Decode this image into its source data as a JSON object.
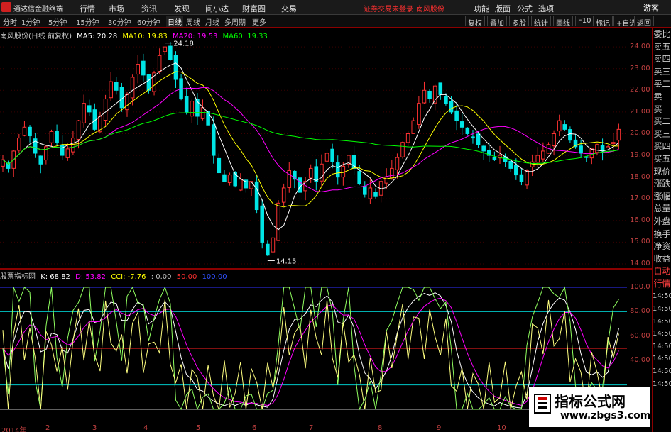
{
  "menubar": {
    "app_title": "通达信金融终端",
    "menus": [
      "行情",
      "市场",
      "资讯",
      "发现",
      "问小达",
      "财富圈",
      "交易"
    ],
    "warning": "证券交易未登录",
    "stock_name": "南风股份",
    "right_items": [
      "功能",
      "版面",
      "公式",
      "选项"
    ],
    "guest_label": "游客"
  },
  "periodbar": {
    "periods": [
      "分时",
      "1分钟",
      "5分钟",
      "15分钟",
      "30分钟",
      "60分钟",
      "日线",
      "周线",
      "月线",
      "多周期",
      "更多"
    ],
    "active_period": "日线",
    "tools": [
      "复权",
      "叠加",
      "多股",
      "统计",
      "画线",
      "F10",
      "标记",
      "+自选",
      "返回"
    ]
  },
  "legend": {
    "stock": "南风股份(日线 前复权)",
    "ma5": "MA5: 20.28",
    "ma10": "MA10: 19.83",
    "ma20": "MA20: 19.53",
    "ma60": "MA60: 19.33",
    "colors": {
      "ma5": "#ffffff",
      "ma10": "#ffff00",
      "ma20": "#ff00ff",
      "ma60": "#00ff00"
    }
  },
  "price_axis": [
    "24.00",
    "23.00",
    "22.00",
    "21.00",
    "20.00",
    "19.00",
    "18.00",
    "17.00",
    "16.00",
    "15.00",
    "14.00"
  ],
  "annotations": {
    "high": "24.18",
    "low": "14.15"
  },
  "indicator": {
    "name": "股票指标网",
    "k": "K: 68.82",
    "d": "D: 53.82",
    "cci": "CCI: -7.76",
    "v0": ": 0.00",
    "v50": "50.00",
    "v100": "100.00",
    "axis": [
      "100.0",
      "80.00",
      "60.00",
      "40.00"
    ]
  },
  "sidebar": [
    "委比",
    "卖五",
    "卖四",
    "卖三",
    "卖二",
    "卖一",
    "买一",
    "买二",
    "买三",
    "买四",
    "买五",
    "现价",
    "涨跌",
    "涨幅",
    "总量",
    "外盘",
    "换手",
    "净资",
    "收益",
    "自动",
    "行情",
    "14:50",
    "14:50",
    "14:50",
    "14:50",
    "14:50",
    "14:50",
    "14:50",
    "14:50"
  ],
  "xaxis": [
    "2014年",
    "2",
    "3",
    "4",
    "5",
    "6",
    "7",
    "8",
    "9",
    "10"
  ],
  "watermark": {
    "title": "指标公式网",
    "url": "www.zbgs3.com"
  },
  "chart_data": {
    "type": "candlestick",
    "title": "南风股份(日线 前复权)",
    "ylim": [
      14.0,
      24.2
    ],
    "close": [
      18.8,
      18.4,
      19.2,
      19.8,
      20.3,
      19.9,
      19.1,
      18.6,
      19.4,
      20.1,
      19.6,
      19.0,
      19.3,
      19.8,
      20.6,
      21.4,
      21.0,
      20.2,
      20.8,
      21.6,
      22.4,
      22.0,
      21.2,
      21.8,
      22.6,
      23.2,
      22.7,
      22.0,
      22.8,
      23.6,
      24.0,
      23.4,
      22.5,
      21.6,
      21.0,
      21.5,
      20.8,
      21.2,
      20.4,
      19.0,
      18.2,
      17.8,
      18.1,
      17.6,
      17.9,
      17.5,
      17.8,
      16.5,
      15.0,
      14.4,
      15.2,
      16.8,
      17.5,
      18.3,
      17.9,
      17.3,
      17.8,
      18.4,
      17.8,
      18.6,
      19.1,
      18.7,
      18.0,
      18.5,
      19.0,
      18.4,
      17.7,
      17.2,
      17.5,
      17.1,
      17.8,
      18.0,
      18.4,
      18.9,
      19.6,
      20.0,
      20.6,
      21.4,
      22.0,
      21.6,
      22.2,
      21.8,
      21.4,
      21.0,
      20.6,
      20.3,
      20.0,
      19.8,
      19.5,
      19.2,
      19.0,
      18.8,
      19.0,
      18.7,
      18.4,
      18.1,
      17.8,
      18.3,
      18.7,
      19.0,
      19.2,
      19.5,
      20.0,
      20.6,
      20.2,
      19.7,
      19.4,
      19.1,
      18.9,
      19.3,
      19.5,
      19.2,
      19.4,
      19.6,
      20.2
    ],
    "ma_latest": {
      "MA5": 20.28,
      "MA10": 19.83,
      "MA20": 19.53,
      "MA60": 19.33
    },
    "high_marker": 24.18,
    "low_marker": 14.15,
    "indicator_lines": {
      "K": 68.82,
      "D": 53.82,
      "CCI": -7.76
    },
    "indicator_levels": [
      0,
      50,
      100
    ]
  }
}
